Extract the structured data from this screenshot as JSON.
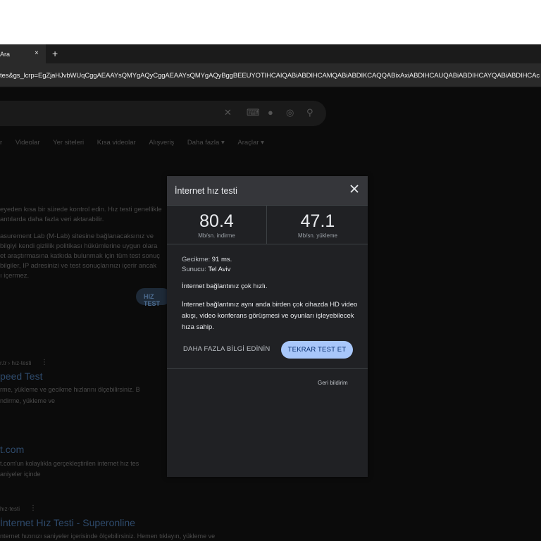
{
  "browser": {
    "tab_title": "Ara",
    "tab_close": "×",
    "new_tab": "+",
    "url": "tes&gs_lcrp=EgZjaHJvbWUqCggAEAAYsQMYgAQyCggAEAAYsQMYgAQyBggBEEUYOTIHCAIQABiABDIHCAMQABiABDIKCAQQABixAxiABDIHCAUQABiABDIHCAYQABiABDIHCAc"
  },
  "background": {
    "filters": [
      "r",
      "Videolar",
      "Yer siteleri",
      "Kısa videolar",
      "Alışveriş",
      "Daha fazla ▾",
      "Araçlar ▾"
    ],
    "lines": [
      "eyeden kısa bir sürede kontrol edin. Hız testi genellikle",
      "antılarda daha fazla veri aktarabilir.",
      "asurement Lab (M-Lab) sitesine bağlanacaksınız ve",
      "bilgiyi kendi gizlilik politikası hükümlerine uygun olara",
      "et araştırmasına katkıda bulunmak için tüm test sonuç",
      "bilgiler, IP adresinizi ve test sonuçlarınızı içerir ancak",
      "ı içermez."
    ],
    "hiz_button": "HIZ TEST",
    "results": [
      {
        "url": "r.tr › hız-testi",
        "title": "peed Test",
        "sub1": "rme, yükleme ve gecikme hızlarını ölçebilirsiniz. B",
        "sub2": "ndirme, yükleme ve"
      },
      {
        "url": "",
        "title": "t.com",
        "sub1": "t.com'un kolaylıkla gerçekleştirilen internet hız tes",
        "sub2": "aniyeler içinde"
      },
      {
        "url": "hız-testi",
        "title": "İnternet Hız Testi - Superonline",
        "sub1": "nternet hızınızı saniyeler içerisinde ölçebilirsiniz. Hemen tıklayın, yükleme ve",
        "sub2": ""
      }
    ]
  },
  "dialog": {
    "title": "İnternet hız testi",
    "download": {
      "value": "80.4",
      "label": "Mb/sn. indirme"
    },
    "upload": {
      "value": "47.1",
      "label": "Mb/sn. yükleme"
    },
    "latency_label": "Gecikme:",
    "latency_value": "91 ms.",
    "server_label": "Sunucu:",
    "server_value": "Tel Aviv",
    "status": "İnternet bağlantınız çok hızlı.",
    "description": "İnternet bağlantınız aynı anda birden çok cihazda HD video akışı, video konferans görüşmesi ve oyunları işleyebilecek hıza sahip.",
    "more_button": "DAHA FAZLA BİLGİ EDİNİN",
    "retest_button": "TEKRAR TEST ET",
    "feedback": "Geri bildirim"
  },
  "colors": {
    "dialog_bg": "#202124",
    "header_bg": "#35363a",
    "accent": "#a8c7fa"
  }
}
